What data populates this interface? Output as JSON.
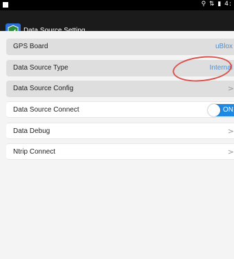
{
  "statusbar": {
    "icons_text": "⚲ ⇅ ▮ 4:"
  },
  "appbar": {
    "title": "Data Source Setting",
    "app_icon": "shield-check-icon"
  },
  "settings": {
    "rows": [
      {
        "label": "GPS Board",
        "value": "uBlox"
      },
      {
        "label": "Data Source Type",
        "value": "Internal"
      },
      {
        "label": "Data Source Config",
        "chevron": ">"
      },
      {
        "label": "Data Source Connect",
        "toggle_label": "ON",
        "toggle_state": "on"
      },
      {
        "label": "Data Debug",
        "chevron": ">"
      },
      {
        "label": "Ntrip Connect",
        "chevron": ">"
      }
    ]
  },
  "colors": {
    "accent": "#1e88e5",
    "value_text": "#4a90d9",
    "annotation": "#d9534f",
    "appbar": "#1b1b1b"
  }
}
